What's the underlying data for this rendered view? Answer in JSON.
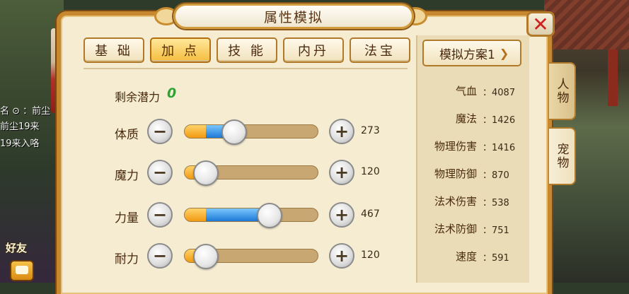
{
  "window": {
    "title": "属性模拟",
    "close_icon": "close-icon"
  },
  "tabs": [
    {
      "label": "基 础",
      "active": false
    },
    {
      "label": "加 点",
      "active": true
    },
    {
      "label": "技 能",
      "active": false
    },
    {
      "label": "内丹",
      "active": false
    },
    {
      "label": "法宝",
      "active": false
    }
  ],
  "potential": {
    "label": "剩余潜力",
    "value": "0"
  },
  "attributes": [
    {
      "label": "体质",
      "value": "273",
      "fill_base": 0.16,
      "fill_added": 0.22,
      "knob": 0.37
    },
    {
      "label": "魔力",
      "value": "120",
      "fill_base": 0.16,
      "fill_added": 0.0,
      "knob": 0.16
    },
    {
      "label": "力量",
      "value": "467",
      "fill_base": 0.16,
      "fill_added": 0.49,
      "knob": 0.64
    },
    {
      "label": "耐力",
      "value": "120",
      "fill_base": 0.16,
      "fill_added": 0.0,
      "knob": 0.16
    }
  ],
  "plan": {
    "label": "模拟方案1",
    "icon": "chevron-down-icon"
  },
  "stats": [
    {
      "name": "气血",
      "value": "：4087"
    },
    {
      "name": "魔法",
      "value": "：1426"
    },
    {
      "name": "物理伤害",
      "value": "：1416"
    },
    {
      "name": "物理防御",
      "value": "：870"
    },
    {
      "name": "法术伤害",
      "value": "：538"
    },
    {
      "name": "法术防御",
      "value": "：751"
    },
    {
      "name": "速度",
      "value": "：591"
    }
  ],
  "side_tabs": [
    {
      "label": "人物",
      "active": false
    },
    {
      "label": "宠物",
      "active": true
    }
  ],
  "background": {
    "chat_lines": [
      "名 ⊙ ：前尘",
      "前尘19来",
      "19来入咯"
    ],
    "friend_label": "好友"
  },
  "colors": {
    "accent": "#f4bd3e",
    "frame": "#c7882f",
    "added_points": "#1d79d6",
    "potential": "#2fa233",
    "close": "#d11f1f"
  }
}
